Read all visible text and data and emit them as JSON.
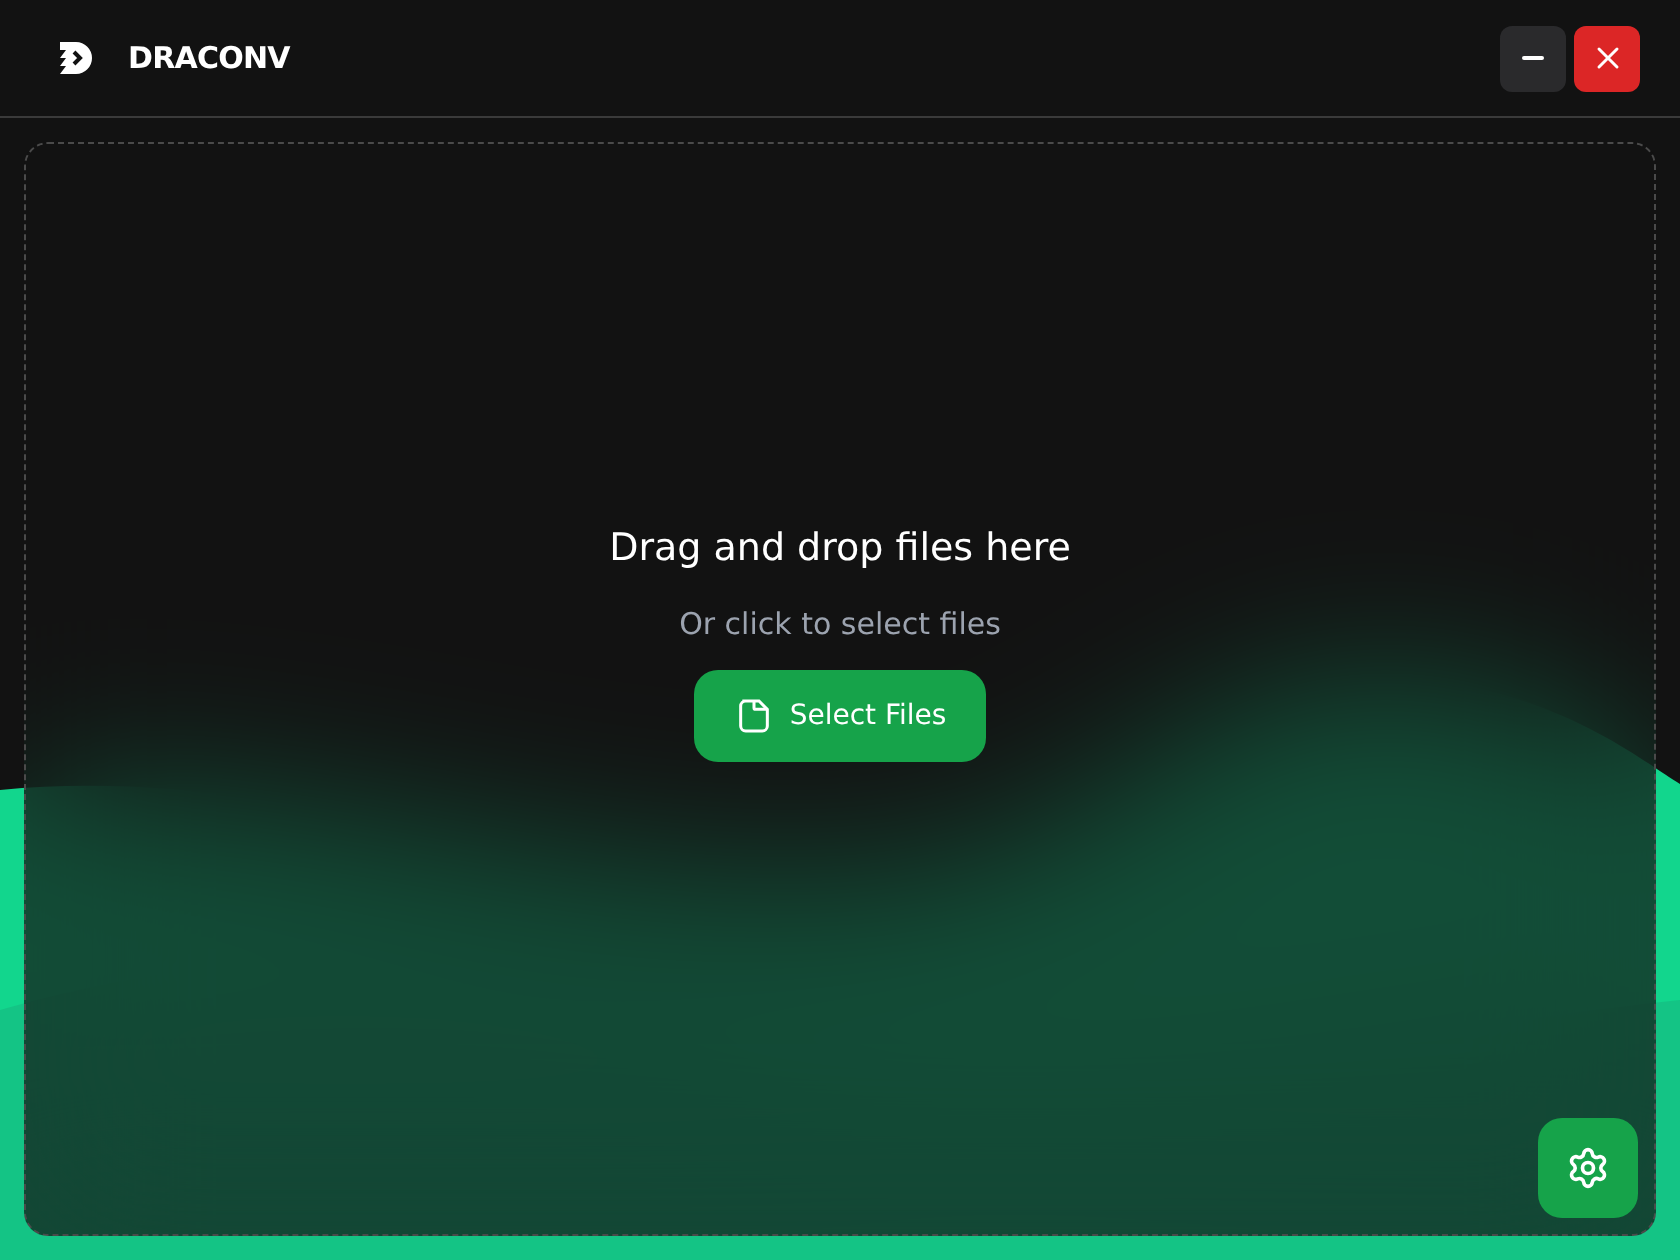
{
  "window": {
    "title": "DRACONV"
  },
  "window_controls": [
    {
      "kind": "minimize"
    },
    {
      "kind": "close"
    }
  ],
  "drop_zone": {
    "heading": "Drag and drop files here",
    "subtitle": "Or click to select files",
    "button": "Select Files"
  }
}
